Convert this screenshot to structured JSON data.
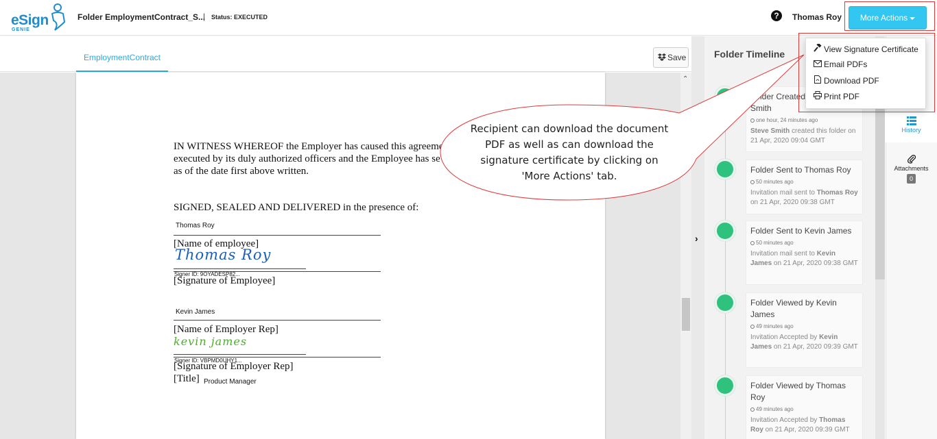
{
  "header": {
    "logo_text": "eSign",
    "logo_sub": "GENIE",
    "folder_title": "Folder EmploymentContract_S...",
    "separator": "|",
    "status": "Status: EXECUTED",
    "help_glyph": "?",
    "user_name": "Thomas Roy",
    "more_actions_label": "More Actions"
  },
  "dropdown": {
    "items": [
      {
        "label": "View Signature Certificate",
        "icon": "hammer-icon"
      },
      {
        "label": "Email PDFs",
        "icon": "envelope-icon"
      },
      {
        "label": "Download PDF",
        "icon": "file-pdf-icon"
      },
      {
        "label": "Print PDF",
        "icon": "printer-icon"
      }
    ]
  },
  "document": {
    "tab_label": "EmploymentContract",
    "save_label": "Save",
    "witness_line1": "IN WITNESS WHEREOF the Employer has caused this agreeme",
    "witness_line2": "executed by its duly authorized officers and the Employee has se",
    "witness_line3": "as of the date first above written.",
    "signed_line": "SIGNED, SEALED AND DELIVERED in the presence of:",
    "employee_name": "Thomas Roy",
    "employee_name_label": "[Name of employee]",
    "employee_signature": "Thomas Roy",
    "employee_signer_id": "Signer ID: 9OYADESP82...",
    "employee_signature_label": "[Signature of Employee]",
    "employer_name": "Kevin James",
    "employer_name_label": "[Name of Employer Rep]",
    "employer_signature": "kevin james",
    "employer_signer_id": "Signer ID: VBPMD0UHY1...",
    "employer_signature_label": "[Signature of Employer Rep]",
    "title_label": "[Title]",
    "title_value": "Product Manager"
  },
  "callout": {
    "text": "Recipient can download the document PDF as well as can download the signature certificate by clicking on 'More Actions' tab."
  },
  "timeline": {
    "title": "Folder Timeline",
    "events": [
      {
        "title": "Folder Created by Steve Smith",
        "time": "one hour, 24 minutes ago",
        "desc_bold": "Steve Smith",
        "desc": " created this folder on 21 Apr, 2020 09:04 GMT"
      },
      {
        "title": "Folder Sent to Thomas Roy",
        "time": "50 minutes ago",
        "desc_pre": "Invitation mail sent to ",
        "desc_bold": "Thomas Roy",
        "desc": " on 21 Apr, 2020 09:38 GMT"
      },
      {
        "title": "Folder Sent to Kevin James",
        "time": "50 minutes ago",
        "desc_pre": "Invitation mail sent to ",
        "desc_bold": "Kevin James",
        "desc": " on 21 Apr, 2020 09:38 GMT"
      },
      {
        "title": "Folder Viewed by Kevin James",
        "time": "49 minutes ago",
        "desc_pre": "Invitation Accepted by ",
        "desc_bold": "Kevin James",
        "desc": " on 21 Apr, 2020 09:39 GMT"
      },
      {
        "title": "Folder Viewed by Thomas Roy",
        "time": "49 minutes ago",
        "desc_pre": "Invitation Accepted by ",
        "desc_bold": "Thomas Roy",
        "desc": " on 21 Apr, 2020 09:39 GMT"
      }
    ]
  },
  "right_strip": {
    "history_label": "History",
    "attachments_label": "Attachments",
    "attachments_count": "0"
  },
  "colors": {
    "brand": "#1f8ccf",
    "accent": "#33c6f0",
    "thumb_green": "#2ec27e",
    "callout_border": "#e03a3a"
  }
}
